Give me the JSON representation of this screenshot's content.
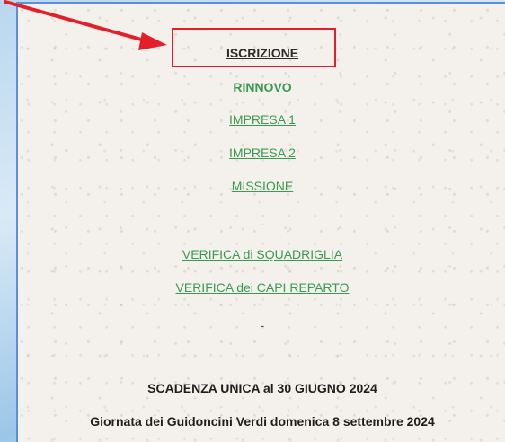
{
  "links": {
    "iscrizione": "ISCRIZIONE",
    "rinnovo": "RINNOVO",
    "impresa1": "IMPRESA 1",
    "impresa2": "IMPRESA 2",
    "missione": "MISSIONE",
    "verifica_squadriglia": "VERIFICA di SQUADRIGLIA",
    "verifica_capi": "VERIFICA dei CAPI REPARTO"
  },
  "separator": "-",
  "deadline": "SCADENZA UNICA al 30 GIUGNO 2024",
  "event": "Giornata dei Guidoncini Verdi domenica 8 settembre 2024",
  "colors": {
    "link_green": "#3a9a52",
    "highlight_red": "#e3202a",
    "frame_blue": "#5b8fd6"
  }
}
